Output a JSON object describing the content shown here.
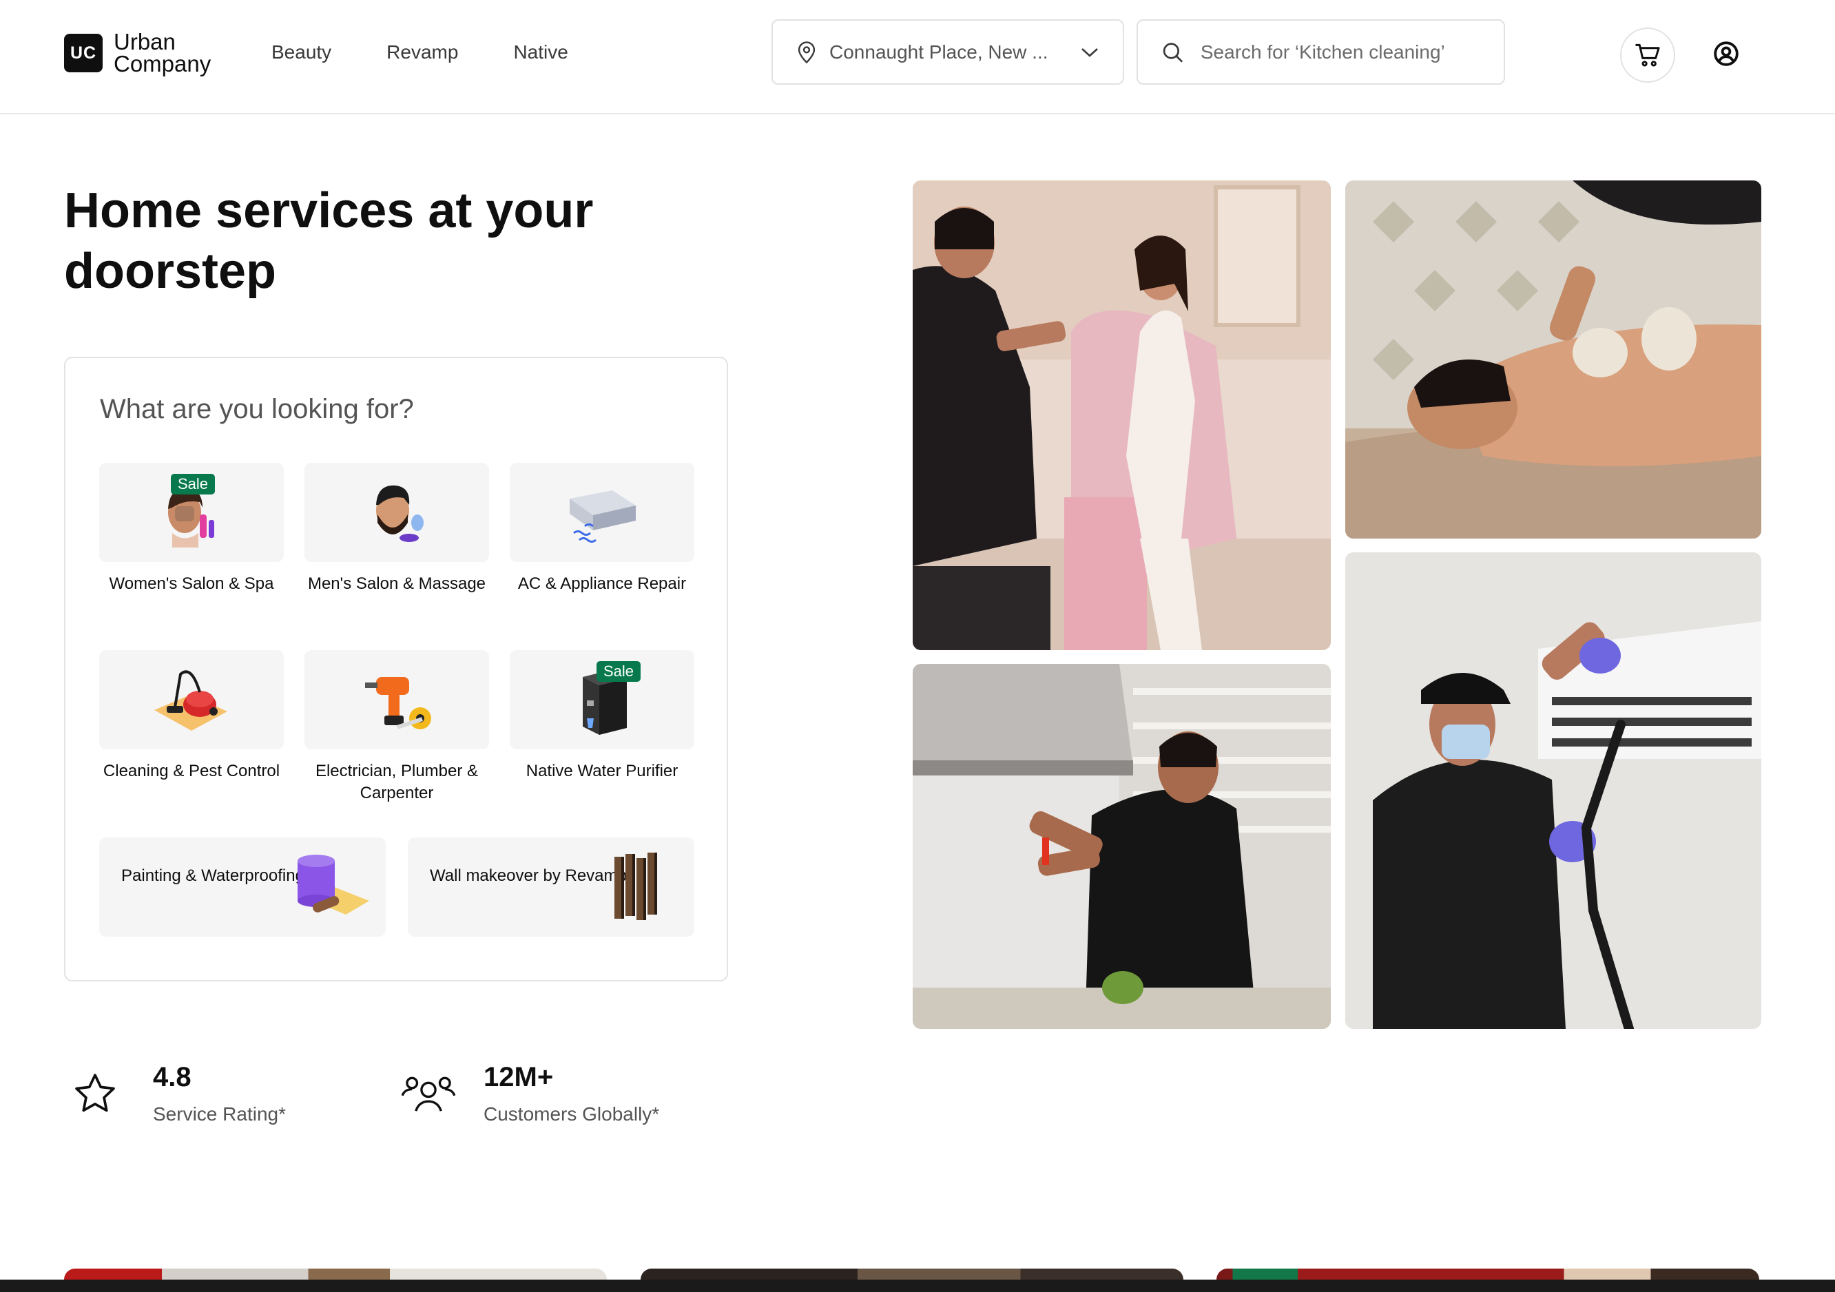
{
  "header": {
    "logo": {
      "mark": "UC",
      "line1": "Urban",
      "line2": "Company"
    },
    "nav": [
      "Beauty",
      "Revamp",
      "Native"
    ],
    "location": {
      "text": "Connaught Place, New ...",
      "icon": "map-pin-icon"
    },
    "search": {
      "placeholder": "Search for ‘Kitchen cleaning’",
      "icon": "search-icon"
    },
    "cart_icon": "cart-icon",
    "account_icon": "user-circle-icon"
  },
  "hero": {
    "title": "Home services at your doorstep"
  },
  "services": {
    "heading": "What are you looking for?",
    "tiles": [
      {
        "label": "Women's Salon & Spa",
        "badge": "Sale"
      },
      {
        "label": "Men's Salon & Massage",
        "badge": ""
      },
      {
        "label": "AC & Appliance Repair",
        "badge": ""
      },
      {
        "label": "Cleaning & Pest Control",
        "badge": ""
      },
      {
        "label": "Electrician, Plumber & Carpenter",
        "badge": ""
      },
      {
        "label": "Native Water Purifier",
        "badge": "Sale"
      }
    ],
    "wide_tiles": [
      {
        "label": "Painting & Waterproofing"
      },
      {
        "label": "Wall makeover by Revamp"
      }
    ]
  },
  "stats": [
    {
      "value": "4.8",
      "caption": "Service Rating*",
      "icon": "star-icon"
    },
    {
      "value": "12M+",
      "caption": "Customers Globally*",
      "icon": "users-icon"
    }
  ],
  "colors": {
    "brand": "#0f0f0f",
    "sale_badge": "#07794c",
    "tile_bg": "#f5f5f5",
    "border": "#e3e3e3"
  }
}
